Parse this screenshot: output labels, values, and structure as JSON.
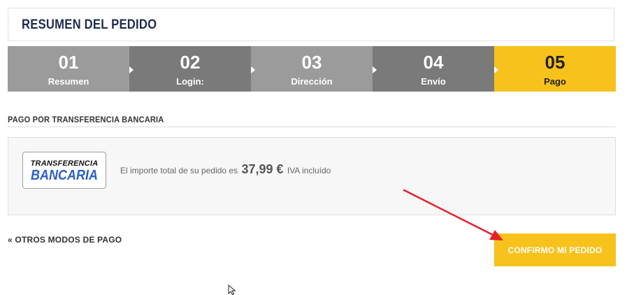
{
  "header": {
    "title": "RESUMEN DEL PEDIDO"
  },
  "steps": [
    {
      "number": "01",
      "label": "Resumen",
      "state": "done"
    },
    {
      "number": "02",
      "label": "Login:",
      "state": "done"
    },
    {
      "number": "03",
      "label": "Dirección",
      "state": "done"
    },
    {
      "number": "04",
      "label": "Envío",
      "state": "done"
    },
    {
      "number": "05",
      "label": "Pago",
      "state": "active"
    }
  ],
  "payment": {
    "section_title": "PAGO POR TRANSFERENCIA BANCARIA",
    "logo_line1": "TRANSFERENCIA",
    "logo_line2": "BANCARIA",
    "amount_prefix": "El importe total de su pedido es",
    "amount": "37,99 €",
    "amount_suffix": "IVA incluído"
  },
  "actions": {
    "other_methods_label": "« OTROS MODOS DE PAGO",
    "confirm_label": "CONFIRMO MI PEDIDO"
  },
  "colors": {
    "accent": "#f8c21c",
    "step_light": "#9b9b9b",
    "step_dark": "#7a7a7a",
    "title": "#1f2b4f",
    "annotation_arrow": "#e3202a"
  }
}
